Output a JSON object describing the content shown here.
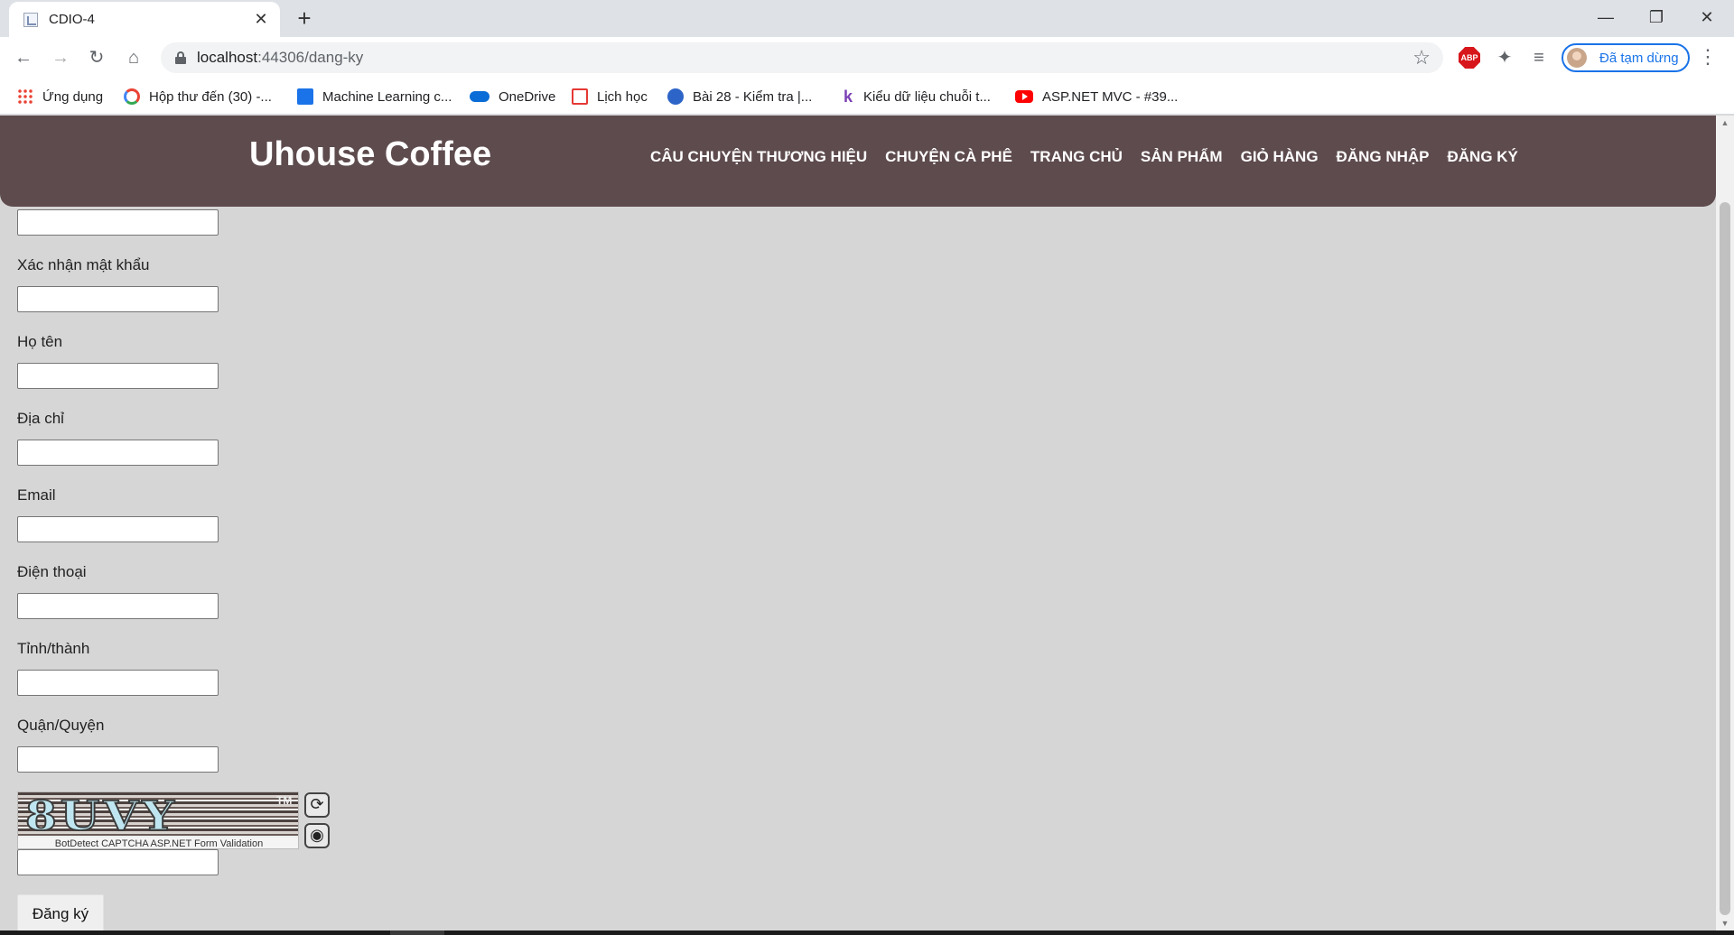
{
  "browser": {
    "tab_title": "CDIO-4",
    "tab_close": "✕",
    "new_tab": "+",
    "window_controls": {
      "minimize": "—",
      "restore": "❐",
      "close": "✕"
    },
    "nav_icons": {
      "back": "←",
      "forward": "→",
      "reload": "↻",
      "home": "⌂"
    },
    "url_host": "localhost",
    "url_path": ":44306/dang-ky",
    "star": "☆",
    "abp_label": "ABP",
    "extensions_icon": "✦",
    "media_icon": "≡",
    "profile_label": "Đã tạm dừng",
    "menu": "⋮"
  },
  "bookmarks": [
    {
      "label": "Ứng dụng",
      "icon": "apps-icon"
    },
    {
      "label": "Hộp thư đến (30) -...",
      "icon": "google-icon"
    },
    {
      "label": "Machine Learning c...",
      "icon": "ml-icon"
    },
    {
      "label": "OneDrive",
      "icon": "onedrive-icon"
    },
    {
      "label": "Lịch học",
      "icon": "calendar-icon"
    },
    {
      "label": "Bài 28 - Kiểm tra |...",
      "icon": "globe-icon"
    },
    {
      "label": "Kiểu dữ liệu chuỗi t...",
      "icon": "k-icon"
    },
    {
      "label": "ASP.NET MVC - #39...",
      "icon": "youtube-icon"
    }
  ],
  "site": {
    "brand": "Uhouse Coffee",
    "nav": [
      "CÂU CHUYỆN THƯƠNG HIỆU",
      "CHUYỆN CÀ PHÊ",
      "TRANG CHỦ",
      "SẢN PHẨM",
      "GIỎ HÀNG",
      "ĐĂNG NHẬP",
      "ĐĂNG KÝ"
    ]
  },
  "form": {
    "fields": [
      {
        "label": "Xác nhận mật khẩu",
        "value": ""
      },
      {
        "label": "Họ tên",
        "value": ""
      },
      {
        "label": "Địa chỉ",
        "value": ""
      },
      {
        "label": "Email",
        "value": ""
      },
      {
        "label": "Điện thoại",
        "value": ""
      },
      {
        "label": "Tỉnh/thành",
        "value": ""
      },
      {
        "label": "Quận/Quyện",
        "value": ""
      }
    ],
    "captcha_text": "8UVY",
    "captcha_tm": "TM",
    "captcha_caption": "BotDetect CAPTCHA ASP.NET Form Validation",
    "captcha_reload_icon": "⟳",
    "captcha_sound_icon": "◉",
    "submit_label": "Đăng ký"
  }
}
